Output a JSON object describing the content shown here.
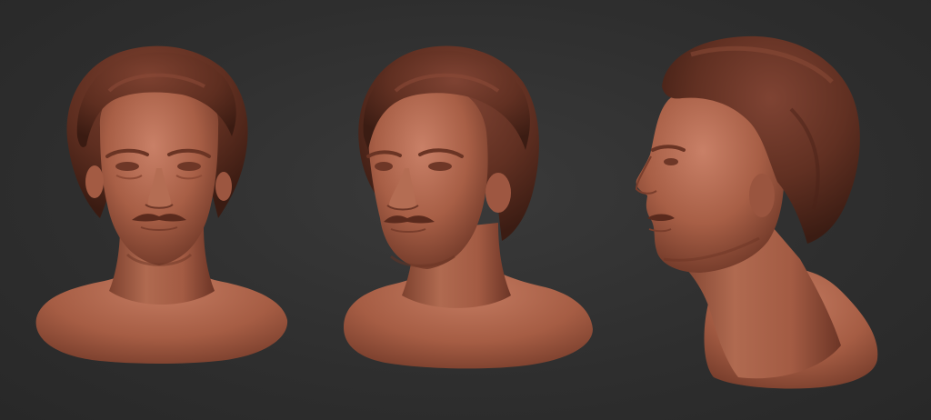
{
  "scene": {
    "background_color": "#2f2f2f",
    "skin_color": "#b4694f",
    "skin_shadow_color": "#7a3e2c",
    "hair_color": "#6a3424",
    "hair_shadow_color": "#3e1d14",
    "views": [
      {
        "name": "front-view",
        "description": "front"
      },
      {
        "name": "three-quarter-view",
        "description": "three-quarter"
      },
      {
        "name": "profile-view",
        "description": "side profile"
      }
    ]
  }
}
